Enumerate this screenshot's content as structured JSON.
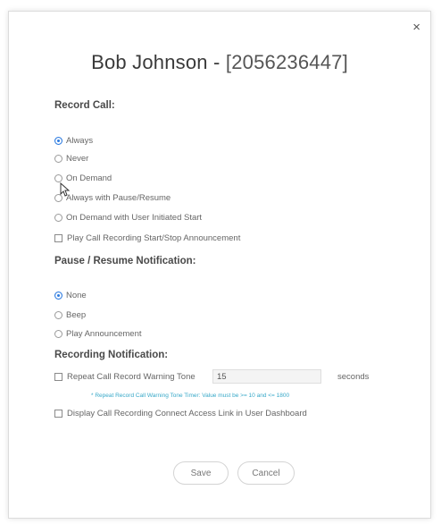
{
  "dialog": {
    "close_glyph": "×",
    "name": "Bob Johnson",
    "separator": " - ",
    "number": "[2056236447]"
  },
  "record_call": {
    "heading": "Record Call:",
    "options": [
      "Always",
      "Never",
      "On Demand",
      "Always with Pause/Resume",
      "On Demand with User Initiated Start"
    ],
    "selected": "Always",
    "announcement_checkbox": "Play Call Recording Start/Stop Announcement"
  },
  "pause_resume": {
    "heading": "Pause / Resume Notification:",
    "options": [
      "None",
      "Beep",
      "Play Announcement"
    ],
    "selected": "None"
  },
  "recording_notification": {
    "heading": "Recording Notification:",
    "repeat_label": "Repeat Call Record Warning Tone",
    "tone_value": "15",
    "seconds_label": "seconds",
    "hint": "* Repeat Record Call Warning Tone Timer: Value must be >= 10 and <= 1800",
    "dashboard_checkbox": "Display Call Recording Connect Access Link in User Dashboard"
  },
  "actions": {
    "save": "Save",
    "cancel": "Cancel"
  },
  "colors": {
    "accent": "#2d7be0",
    "hint": "#37a8c8"
  }
}
